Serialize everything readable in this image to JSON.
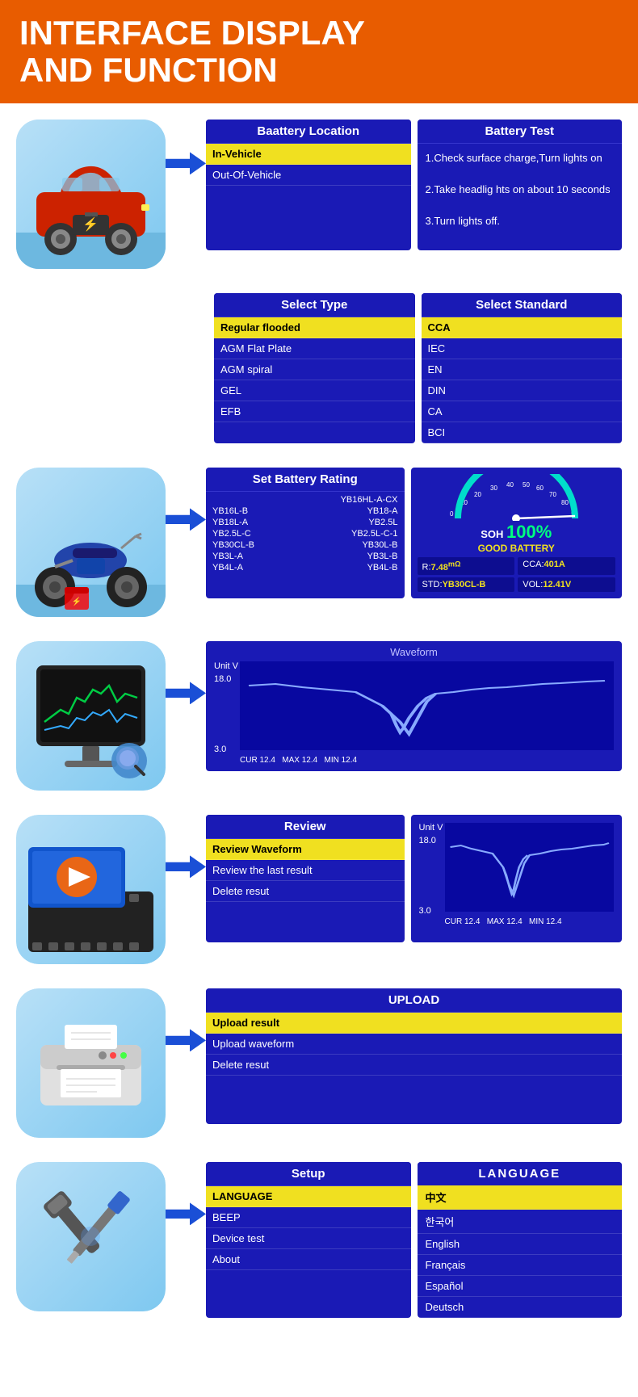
{
  "header": {
    "title_line1": "INTERFACE DISPLAY",
    "title_line2": "AND FUNCTION"
  },
  "rows": [
    {
      "id": "car-row",
      "icon": "car",
      "panels": [
        {
          "id": "battery-location",
          "header": "Baattery Location",
          "items": [
            {
              "text": "In-Vehicle",
              "highlighted": true
            },
            {
              "text": "Out-Of-Vehicle",
              "highlighted": false
            }
          ]
        },
        {
          "id": "battery-test",
          "header": "Battery Test",
          "text": "1.Check surface charge,Turn lights on\n\n2.Take headlig hts on about 10 seconds\n\n3.Turn lights off."
        }
      ]
    },
    {
      "id": "type-row",
      "icon": "none",
      "panels": [
        {
          "id": "select-type",
          "header": "Select  Type",
          "items": [
            {
              "text": "Regular flooded",
              "highlighted": true
            },
            {
              "text": "AGM Flat Plate",
              "highlighted": false
            },
            {
              "text": "AGM spiral",
              "highlighted": false
            },
            {
              "text": "GEL",
              "highlighted": false
            },
            {
              "text": "EFB",
              "highlighted": false
            }
          ]
        },
        {
          "id": "select-standard",
          "header": "Select  Standard",
          "items": [
            {
              "text": "CCA",
              "highlighted": true
            },
            {
              "text": "IEC",
              "highlighted": false
            },
            {
              "text": "EN",
              "highlighted": false
            },
            {
              "text": "DIN",
              "highlighted": false
            },
            {
              "text": "CA",
              "highlighted": false
            },
            {
              "text": "BCI",
              "highlighted": false
            }
          ]
        }
      ]
    },
    {
      "id": "moto-row",
      "icon": "motorcycle",
      "panels": [
        {
          "id": "battery-rating",
          "header": "Set  Battery Rating",
          "ratings": [
            {
              "col1": "",
              "col2": "YB16HL-A-CX"
            },
            {
              "col1": "YB16L-B",
              "col2": "YB18-A"
            },
            {
              "col1": "YB18L-A",
              "col2": "YB2.5L"
            },
            {
              "col1": "YB2.5L-C",
              "col2": "YB2.5L-C-1"
            },
            {
              "col1": "YB30CL-B",
              "col2": "YB30L-B"
            },
            {
              "col1": "YB3L-A",
              "col2": "YB3L-B"
            },
            {
              "col1": "YB4L-A",
              "col2": "YB4L-B"
            }
          ]
        },
        {
          "id": "soh-display",
          "soh_percent": "100%",
          "soh_label": "GOOD BATTERY",
          "resistance": "7.48",
          "resistance_unit": "mΩ",
          "cca": "401A",
          "std": "YB30CL-B",
          "vol": "12.41V"
        }
      ]
    },
    {
      "id": "monitor-row",
      "icon": "monitor",
      "panels": [
        {
          "id": "waveform",
          "header": "Waveform",
          "unit": "Unit  V",
          "max_val": "18.0",
          "min_val": "3.0",
          "cur": "CUR 12.4",
          "max": "MAX 12.4",
          "min": "MIN 12.4"
        }
      ]
    },
    {
      "id": "review-row",
      "icon": "video",
      "panels": [
        {
          "id": "review-menu",
          "header": "Review",
          "items": [
            {
              "text": "Review Waveform",
              "highlighted": true
            },
            {
              "text": "Review the last result",
              "highlighted": false
            },
            {
              "text": "Delete resut",
              "highlighted": false
            }
          ]
        },
        {
          "id": "review-waveform",
          "unit": "Unit  V",
          "max_val": "18.0",
          "min_val": "3.0",
          "cur": "CUR 12.4",
          "max": "MAX 12.4",
          "min": "MIN 12.4"
        }
      ]
    },
    {
      "id": "upload-row",
      "icon": "printer",
      "panels": [
        {
          "id": "upload-menu",
          "header": "UPLOAD",
          "items": [
            {
              "text": "Upload result",
              "highlighted": true
            },
            {
              "text": "Upload waveform",
              "highlighted": false
            },
            {
              "text": "Delete resut",
              "highlighted": false
            }
          ]
        }
      ]
    },
    {
      "id": "setup-row",
      "icon": "tools",
      "panels": [
        {
          "id": "setup-menu",
          "header": "Setup",
          "items": [
            {
              "text": "LANGUAGE",
              "highlighted": true
            },
            {
              "text": "BEEP",
              "highlighted": false
            },
            {
              "text": "Device test",
              "highlighted": false
            },
            {
              "text": "About",
              "highlighted": false
            }
          ]
        },
        {
          "id": "language-menu",
          "header": "LANGUAGE",
          "items": [
            {
              "text": "中文",
              "highlighted": true
            },
            {
              "text": "한국어",
              "highlighted": false
            },
            {
              "text": "English",
              "highlighted": false
            },
            {
              "text": "Français",
              "highlighted": false
            },
            {
              "text": "Español",
              "highlighted": false
            },
            {
              "text": "Deutsch",
              "highlighted": false
            }
          ]
        }
      ]
    }
  ]
}
